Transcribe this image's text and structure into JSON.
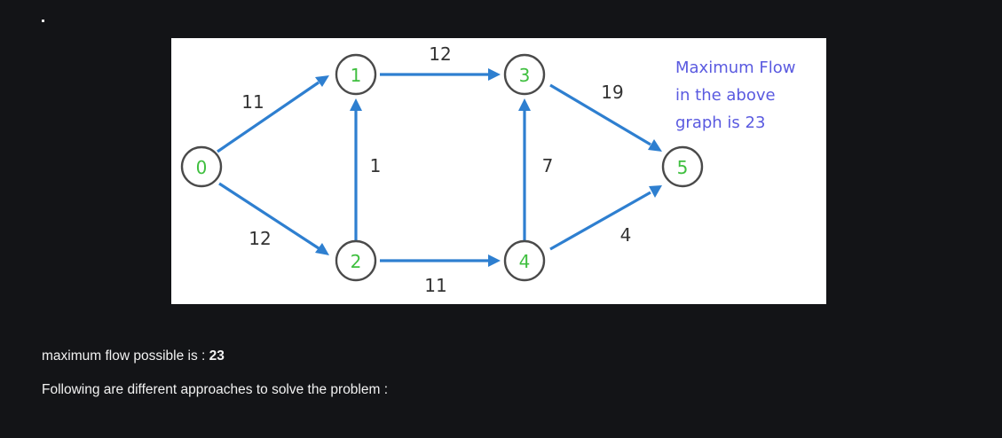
{
  "graph": {
    "nodes": [
      {
        "id": "0",
        "label": "0"
      },
      {
        "id": "1",
        "label": "1"
      },
      {
        "id": "2",
        "label": "2"
      },
      {
        "id": "3",
        "label": "3"
      },
      {
        "id": "4",
        "label": "4"
      },
      {
        "id": "5",
        "label": "5"
      }
    ],
    "edges": [
      {
        "from": "0",
        "to": "1",
        "capacity": "11"
      },
      {
        "from": "0",
        "to": "2",
        "capacity": "12"
      },
      {
        "from": "2",
        "to": "1",
        "capacity": "1"
      },
      {
        "from": "1",
        "to": "3",
        "capacity": "12"
      },
      {
        "from": "2",
        "to": "4",
        "capacity": "11"
      },
      {
        "from": "4",
        "to": "3",
        "capacity": "7"
      },
      {
        "from": "3",
        "to": "5",
        "capacity": "19"
      },
      {
        "from": "4",
        "to": "5",
        "capacity": "4"
      }
    ],
    "note": {
      "line1": "Maximum Flow",
      "line2": "in the above",
      "line3": "graph is 23"
    },
    "colors": {
      "edge": "#2e7fd0",
      "node_label": "#3fbf3f",
      "note_text": "#5a5ae0",
      "page_background": "#131417"
    }
  },
  "result": {
    "label": "maximum flow possible is : ",
    "value": "23"
  },
  "approaches_text": "Following are different approaches to solve the problem :"
}
